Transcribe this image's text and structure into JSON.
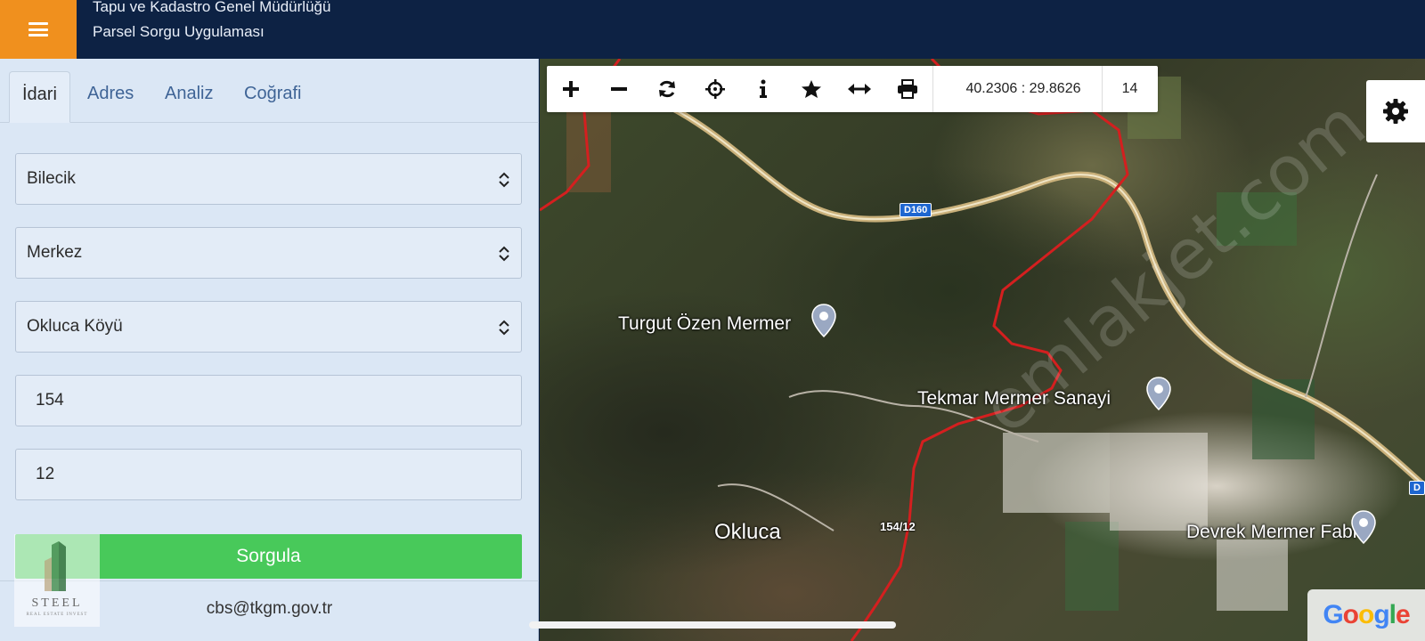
{
  "header": {
    "title": "Tapu ve Kadastro Genel Müdürlüğü",
    "subtitle": "Parsel Sorgu Uygulaması"
  },
  "panel": {
    "tabs": [
      {
        "label": "İdari",
        "active": true
      },
      {
        "label": "Adres",
        "active": false
      },
      {
        "label": "Analiz",
        "active": false
      },
      {
        "label": "Coğrafi",
        "active": false
      }
    ],
    "province": "Bilecik",
    "district": "Merkez",
    "neighborhood": "Okluca Köyü",
    "block": "154",
    "parcel": "12",
    "submit_label": "Sorgula",
    "email": "cbs@tkgm.gov.tr"
  },
  "logo": {
    "brand": "STEEL",
    "tagline": "REAL ESTATE INVEST"
  },
  "map": {
    "toolbar": {
      "coordinates": "40.2306 : 29.8626",
      "zoom_level": "14",
      "tools": [
        "zoom-in",
        "zoom-out",
        "refresh",
        "locate",
        "info",
        "favorite",
        "measure",
        "print"
      ]
    },
    "road_labels": [
      "D160",
      "D"
    ],
    "places": [
      "Turgut Özen Mermer",
      "Tekmar Mermer Sanayi",
      "Okluca",
      "Devrek Mermer Fabr"
    ],
    "parcel_label": "154/12",
    "watermark": "emlakjet.com",
    "attribution": "Google"
  },
  "colors": {
    "header_bg": "#0d2244",
    "menu_accent": "#f0901e",
    "panel_bg": "#dbe7f5",
    "submit_green": "#48c95a",
    "boundary_red": "#d41f1f",
    "tab_link": "#3f6496"
  }
}
